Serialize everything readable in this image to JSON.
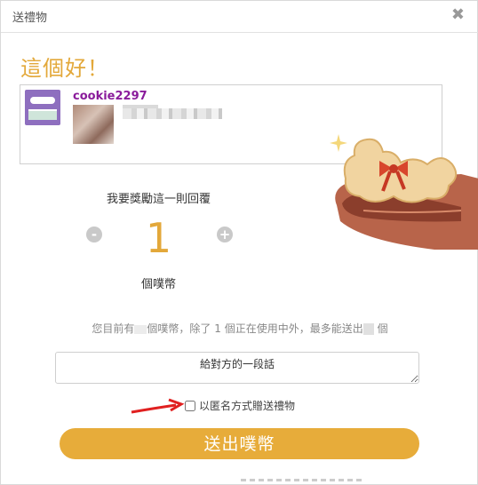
{
  "dialog": {
    "title": "送禮物",
    "close_icon": "close-icon",
    "heading": "這個好！"
  },
  "quote": {
    "username": "cookie2297",
    "avatar_icon": "avatar"
  },
  "gift": {
    "prompt": "我要獎勵這一則回覆",
    "decrement_label": "-",
    "increment_label": "+",
    "count": "1",
    "unit": "個噗幣"
  },
  "info": {
    "part1": "您目前有",
    "part2": "個噗幣，除了",
    "in_use": "1",
    "part3": "個正在使用中外，最多能送出",
    "part4": "個"
  },
  "message": {
    "placeholder": "給對方的一段話"
  },
  "anonymous": {
    "label": "以匿名方式贈送禮物",
    "checked": false
  },
  "submit": {
    "label": "送出噗幣"
  },
  "colors": {
    "accent": "#e3a83a",
    "button": "#e7ac3a",
    "username": "#8a1b9b",
    "arrow": "#e02020"
  }
}
